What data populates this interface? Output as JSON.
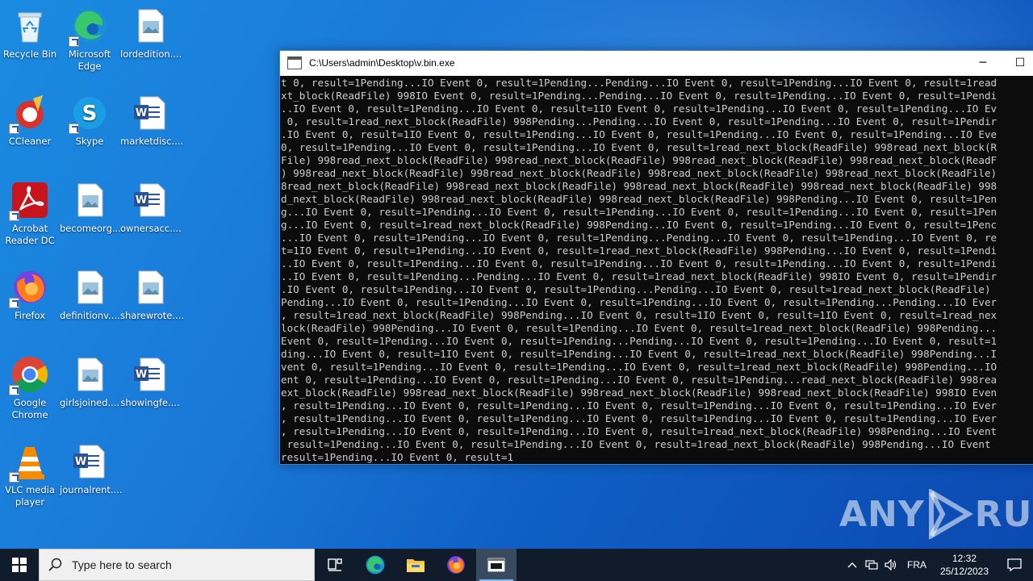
{
  "desktop": {
    "icons": [
      {
        "label": "Recycle Bin",
        "icon": "recycle-bin-icon"
      },
      {
        "label": "Microsoft Edge",
        "icon": "edge-icon"
      },
      {
        "label": "lordedition....",
        "icon": "image-file-icon"
      },
      {
        "label": "CCleaner",
        "icon": "ccleaner-icon"
      },
      {
        "label": "Skype",
        "icon": "skype-icon"
      },
      {
        "label": "marketdisc....",
        "icon": "word-doc-icon"
      },
      {
        "label": "Acrobat Reader DC",
        "icon": "acrobat-icon"
      },
      {
        "label": "becomeorg....",
        "icon": "image-file-icon"
      },
      {
        "label": "ownersacc....",
        "icon": "word-doc-icon"
      },
      {
        "label": "Firefox",
        "icon": "firefox-icon"
      },
      {
        "label": "definitionv....",
        "icon": "image-file-icon"
      },
      {
        "label": "sharewrote....",
        "icon": "image-file-icon"
      },
      {
        "label": "Google Chrome",
        "icon": "chrome-icon"
      },
      {
        "label": "girlsjoined....",
        "icon": "image-file-icon"
      },
      {
        "label": "showingfe....",
        "icon": "word-doc-icon"
      },
      {
        "label": "VLC media player",
        "icon": "vlc-icon"
      },
      {
        "label": "journalrent....",
        "icon": "word-doc-icon"
      }
    ]
  },
  "console_window": {
    "title": "C:\\Users\\admin\\Desktop\\v.bin.exe",
    "minimize": "─",
    "maximize": "☐",
    "lines": [
      "t 0, result=1Pending...IO Event 0, result=1Pending...Pending...IO Event 0, result=1Pending...IO Event 0, result=1read",
      "xt_block(ReadFile) 998IO Event 0, result=1Pending...Pending...IO Event 0, result=1Pending...IO Event 0, result=1Pendi",
      "..IO Event 0, result=1Pending...IO Event 0, result=1IO Event 0, result=1Pending...IO Event 0, result=1Pending...IO Ev",
      " 0, result=1read_next_block(ReadFile) 998Pending...Pending...IO Event 0, result=1Pending...IO Event 0, result=1Pendir",
      ".IO Event 0, result=1IO Event 0, result=1Pending...IO Event 0, result=1Pending...IO Event 0, result=1Pending...IO Eve",
      "0, result=1Pending...IO Event 0, result=1Pending...IO Event 0, result=1read_next_block(ReadFile) 998read_next_block(R",
      "File) 998read_next_block(ReadFile) 998read_next_block(ReadFile) 998read_next_block(ReadFile) 998read_next_block(ReadF",
      ") 998read_next_block(ReadFile) 998read_next_block(ReadFile) 998read_next_block(ReadFile) 998read_next_block(ReadFile)",
      "8read_next_block(ReadFile) 998read_next_block(ReadFile) 998read_next_block(ReadFile) 998read_next_block(ReadFile) 998",
      "d_next_block(ReadFile) 998read_next_block(ReadFile) 998read_next_block(ReadFile) 998Pending...IO Event 0, result=1Pen",
      "g...IO Event 0, result=1Pending...IO Event 0, result=1Pending...IO Event 0, result=1Pending...IO Event 0, result=1Pen",
      "g...IO Event 0, result=1read_next_block(ReadFile) 998Pending...IO Event 0, result=1Pending...IO Event 0, result=1Penc",
      "...IO Event 0, result=1Pending...IO Event 0, result=1Pending...Pending...IO Event 0, result=1Pending...IO Event 0, re",
      "t=1IO Event 0, result=1Pending...IO Event 0, result=1read_next_block(ReadFile) 998Pending...IO Event 0, result=1Pendi",
      "..IO Event 0, result=1Pending...IO Event 0, result=1Pending...IO Event 0, result=1Pending...IO Event 0, result=1Pendi",
      "..IO Event 0, result=1Pending...Pending...IO Event 0, result=1read_next_block(ReadFile) 998IO Event 0, result=1Pendir",
      ".IO Event 0, result=1Pending...IO Event 0, result=1Pending...Pending...IO Event 0, result=1read_next_block(ReadFile) ",
      "Pending...IO Event 0, result=1Pending...IO Event 0, result=1Pending...IO Event 0, result=1Pending...Pending...IO Ever",
      ", result=1read_next_block(ReadFile) 998Pending...IO Event 0, result=1IO Event 0, result=1IO Event 0, result=1read_nex",
      "lock(ReadFile) 998Pending...IO Event 0, result=1Pending...IO Event 0, result=1read_next_block(ReadFile) 998Pending...",
      "Event 0, result=1Pending...IO Event 0, result=1Pending...Pending...IO Event 0, result=1Pending...IO Event 0, result=1",
      "ding...IO Event 0, result=1IO Event 0, result=1Pending...IO Event 0, result=1read_next_block(ReadFile) 998Pending...I",
      "vent 0, result=1Pending...IO Event 0, result=1Pending...IO Event 0, result=1read_next_block(ReadFile) 998Pending...IO",
      "ent 0, result=1Pending...IO Event 0, result=1Pending...IO Event 0, result=1Pending...read_next_block(ReadFile) 998rea",
      "ext_block(ReadFile) 998read_next_block(ReadFile) 998read_next_block(ReadFile) 998read_next_block(ReadFile) 998IO Even",
      ", result=1Pending...IO Event 0, result=1Pending...IO Event 0, result=1Pending...IO Event 0, result=1Pending...IO Ever",
      ", result=1Pending...IO Event 0, result=1Pending...IO Event 0, result=1Pending...IO Event 0, result=1Pending...IO Ever",
      ", result=1Pending...IO Event 0, result=1Pending...IO Event 0, result=1read_next_block(ReadFile) 998Pending...IO Event",
      " result=1Pending...IO Event 0, result=1Pending...IO Event 0, result=1read_next_block(ReadFile) 998Pending...IO Event",
      "result=1Pending...IO Event 0, result=1"
    ]
  },
  "watermark": {
    "left": "ANY",
    "right": "RUN"
  },
  "taskbar": {
    "search_placeholder": "Type here to search",
    "apps": [
      "task-view-icon",
      "edge-icon",
      "file-explorer-icon",
      "firefox-icon",
      "console-icon"
    ],
    "language": "FRA",
    "time": "12:32",
    "date": "25/12/2023"
  }
}
